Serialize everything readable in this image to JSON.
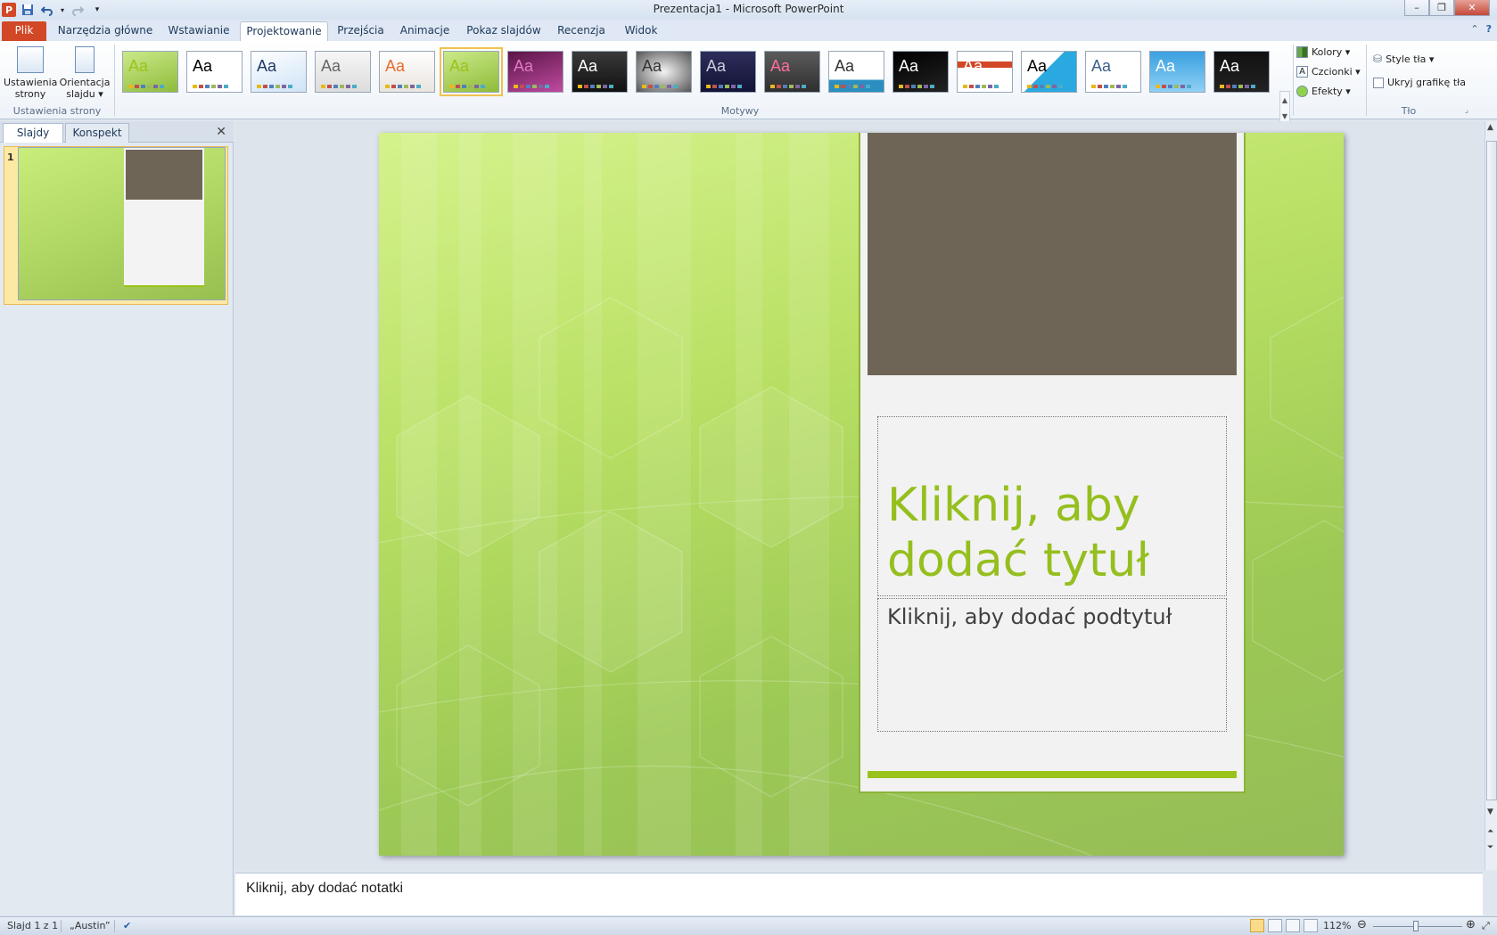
{
  "window": {
    "title": "Prezentacja1  -  Microsoft PowerPoint",
    "app_icon": "P",
    "controls": [
      "–",
      "❐",
      "✕"
    ]
  },
  "qat": {
    "icons": [
      "save-icon",
      "undo-icon",
      "redo-icon",
      "customize-icon"
    ]
  },
  "tabs": [
    "Plik",
    "Narzędzia główne",
    "Wstawianie",
    "Projektowanie",
    "Przejścia",
    "Animacje",
    "Pokaz slajdów",
    "Recenzja",
    "Widok"
  ],
  "active_tab": "Projektowanie",
  "ribbon": {
    "page_setup_group": {
      "label": "Ustawienia strony",
      "page_setup": [
        "Ustawienia",
        "strony"
      ],
      "orientation": [
        "Orientacja",
        "slajdu ▾"
      ]
    },
    "themes_group": {
      "label": "Motywy",
      "theme_text": "Aa",
      "selected_index": 5,
      "count": 18
    },
    "variants": {
      "colors": "Kolory ▾",
      "fonts": "Czcionki ▾",
      "effects": "Efekty ▾"
    },
    "background_group": {
      "label": "Tło",
      "background_styles": "Style tła ▾",
      "hide_graphics": "Ukryj grafikę tła",
      "hide_graphics_checked": false
    }
  },
  "left_pane": {
    "tabs": [
      "Slajdy",
      "Konspekt"
    ],
    "active_tab": "Slajdy",
    "close": "✕",
    "slide_number": "1"
  },
  "slide": {
    "title_placeholder": "Kliknij, aby dodać tytuł",
    "title_lines": [
      "Kliknij, aby",
      "dodać tytuł"
    ],
    "subtitle_placeholder": "Kliknij, aby dodać podtytuł"
  },
  "notes": {
    "placeholder": "Kliknij, aby dodać notatki"
  },
  "status": {
    "slide": "Slajd 1 z 1",
    "theme": "„Austin”",
    "zoom": "112%"
  },
  "colors": {
    "file_tab": "#d24726",
    "title_green": "#95bf1e",
    "accent_bar": "#99c21a",
    "photo_placeholder": "#6f6557"
  }
}
